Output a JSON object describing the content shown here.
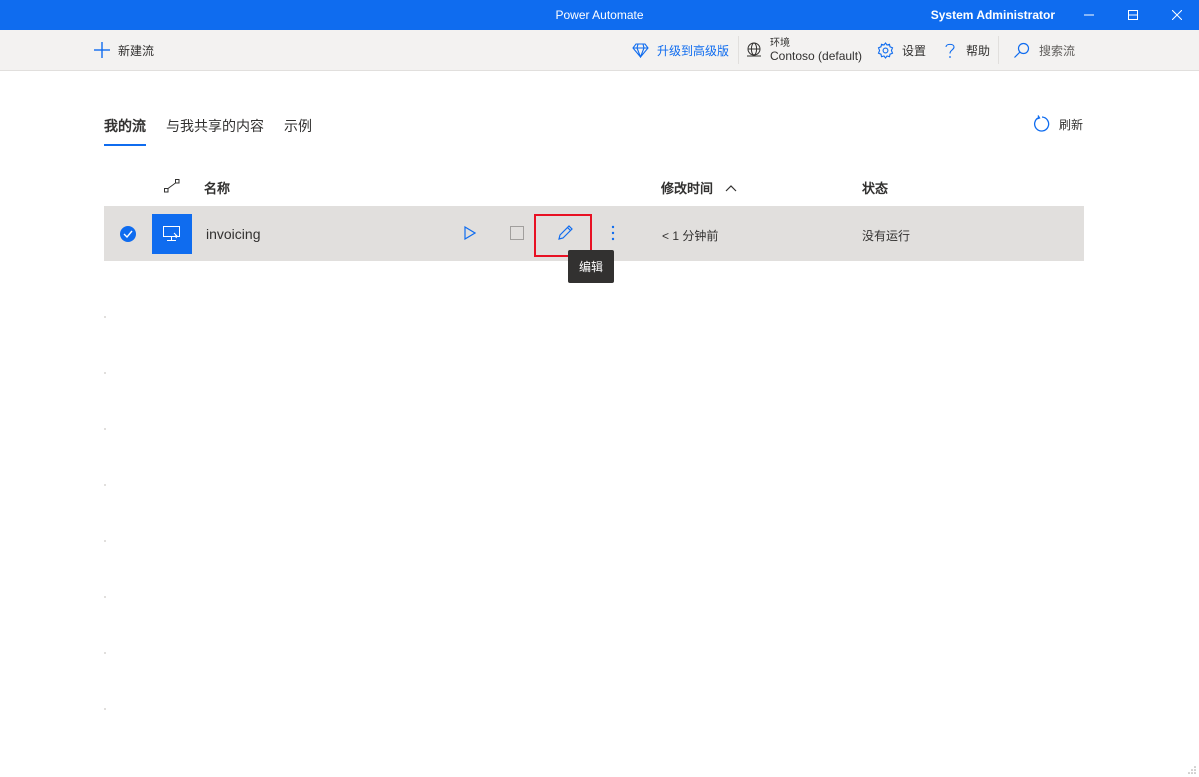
{
  "window": {
    "title": "Power Automate",
    "user": "System Administrator"
  },
  "toolbar": {
    "new_flow": "新建流",
    "upgrade": "升级到高级版",
    "env_label": "环境",
    "env_value": "Contoso (default)",
    "settings": "设置",
    "help": "帮助",
    "search": "搜索流"
  },
  "tabs": [
    {
      "label": "我的流",
      "active": true
    },
    {
      "label": "与我共享的内容",
      "active": false
    },
    {
      "label": "示例",
      "active": false
    }
  ],
  "refresh": "刷新",
  "table": {
    "headers": {
      "name": "名称",
      "modified": "修改时间",
      "status": "状态"
    },
    "rows": [
      {
        "name": "invoicing",
        "modified": "< 1 分钟前",
        "status": "没有运行",
        "selected": true
      }
    ]
  },
  "tooltip": "编辑",
  "colors": {
    "accent": "#0f6cef",
    "highlight": "#e81123",
    "row_selected": "#e1dfdd"
  },
  "icons": [
    "plus-icon",
    "diamond-icon",
    "globe-icon",
    "gear-icon",
    "help-icon",
    "search-icon",
    "refresh-icon",
    "play-icon",
    "stop-icon",
    "pencil-icon",
    "more-icon",
    "desktop-flow-icon",
    "sort-up-icon"
  ]
}
